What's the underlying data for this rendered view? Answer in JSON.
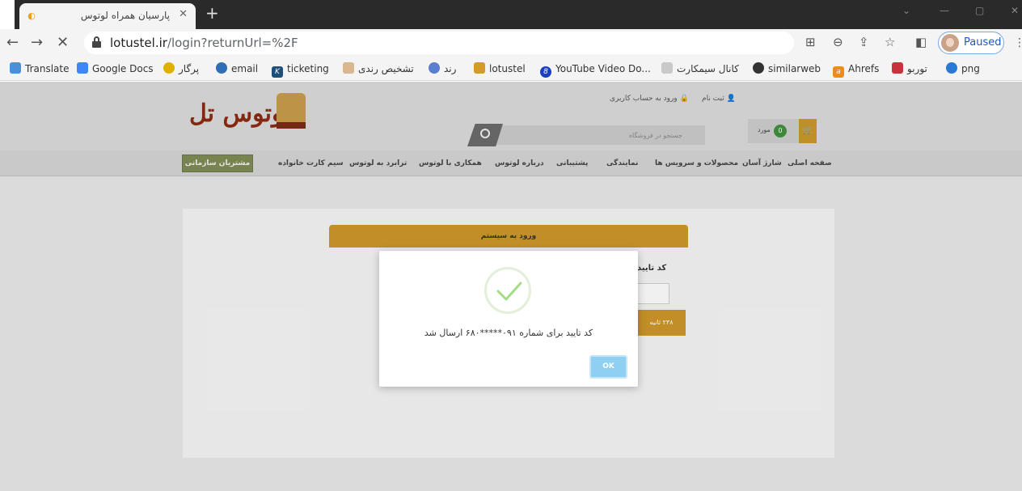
{
  "browser": {
    "tab_title": "پارسیان همراه لوتوس",
    "new_tab": "+",
    "url_host": "lotustel.ir",
    "url_path": "/login?returnUrl=%2F",
    "profile_label": "Paused",
    "bookmarks": [
      {
        "label": "Translate",
        "icon": "translate-icon",
        "color": "#4a90d9"
      },
      {
        "label": "Google Docs",
        "icon": "docs-icon",
        "color": "#4285f4"
      },
      {
        "label": "پرگار",
        "icon": "pargar-icon",
        "color": "#e0b000"
      },
      {
        "label": "email",
        "icon": "email-icon",
        "color": "#2f6fb5"
      },
      {
        "label": "ticketing",
        "icon": "ticketing-icon",
        "color": "#1e4f7a"
      },
      {
        "label": "تشخیص رندی",
        "icon": "rendi-icon",
        "color": "#d9b890"
      },
      {
        "label": "رند",
        "icon": "rond-icon",
        "color": "#5a7fd0"
      },
      {
        "label": "lotustel",
        "icon": "lotustel-icon",
        "color": "#d69a2a"
      },
      {
        "label": "YouTube Video Do...",
        "icon": "youtube-dl-icon",
        "color": "#1a3fbf"
      },
      {
        "label": "کانال سیمکارت",
        "icon": "telegram-icon",
        "color": "#c9c9c9"
      },
      {
        "label": "similarweb",
        "icon": "similarweb-icon",
        "color": "#333333"
      },
      {
        "label": "Ahrefs",
        "icon": "ahrefs-icon",
        "color": "#f08a1c"
      },
      {
        "label": "توربو",
        "icon": "turbo-icon",
        "color": "#c8323c"
      },
      {
        "label": "png",
        "icon": "png-icon",
        "color": "#2a7ad5"
      }
    ]
  },
  "site": {
    "logo_text": "لوتوس تل",
    "top_links": {
      "login": "ورود به حساب کاربری",
      "register": "ثبت نام"
    },
    "search_placeholder": "جستجو در فروشگاه",
    "cart": {
      "count": "0",
      "label": "مورد"
    },
    "nav": [
      "صفحه اصلی",
      "شارژ آسان",
      "محصولات و سرویس ها",
      "نمایندگی",
      "پشتیبانی",
      "درباره لوتوس",
      "همکاری با لوتوس",
      "ترابرد به لوتوس",
      "سیم کارت خانواده"
    ],
    "org_button": "مشتریان سازمانی",
    "login_title": "ورود به سیستم",
    "code_label": "کد تایید",
    "timer": "۲۳۸ ثانیه"
  },
  "modal": {
    "message": "کد تایید برای شماره ۰۹۱*****۶۸۰ ارسال شد",
    "ok_label": "OK",
    "accent": "#8fd0f2"
  }
}
